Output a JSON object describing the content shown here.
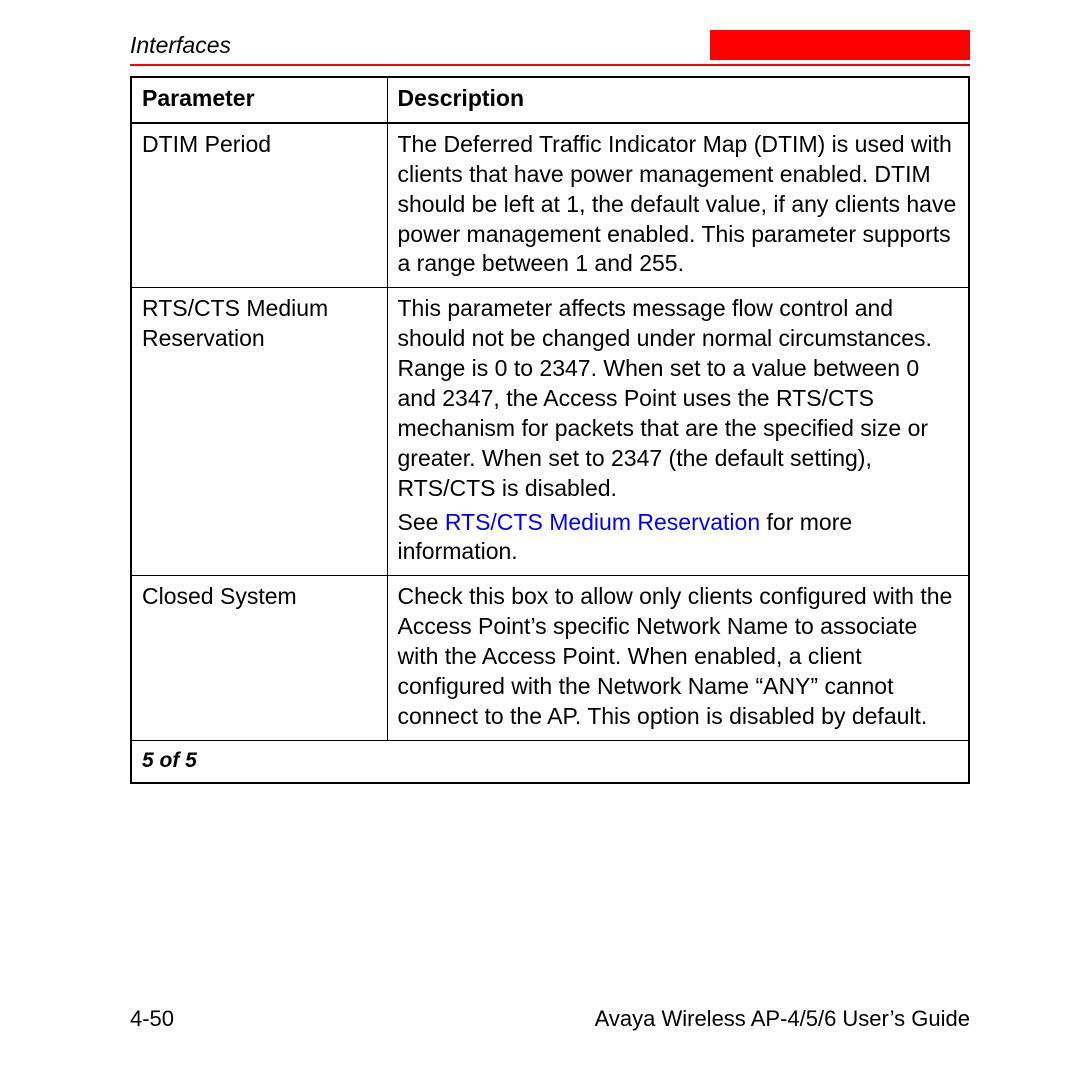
{
  "header": {
    "section": "Interfaces"
  },
  "table": {
    "headers": {
      "param": "Parameter",
      "desc": "Description"
    },
    "rows": [
      {
        "param": "DTIM Period",
        "desc_plain": "The Deferred Traffic Indicator Map (DTIM) is used with clients that have power management enabled. DTIM should be left at 1, the default value, if any clients have power management enabled. This parameter supports a range between 1 and 255."
      },
      {
        "param": "RTS/CTS Medium Reservation",
        "desc_p1": "This parameter affects message flow control and should not be changed under normal circumstances. Range is 0 to 2347. When set to a value between 0 and 2347, the Access Point uses the RTS/CTS mechanism for packets that are the specified size or greater. When set to 2347 (the default setting), RTS/CTS is disabled.",
        "desc_p2_pre": "See ",
        "desc_p2_link": "RTS/CTS Medium Reservation",
        "desc_p2_post": " for more information."
      },
      {
        "param": "Closed System",
        "desc_plain": "Check this box to allow only clients configured with the Access Point’s specific Network Name to associate with the Access Point. When enabled, a client configured with the Network Name “ANY” cannot connect to the AP. This option is disabled by default."
      }
    ],
    "pager": "5 of 5"
  },
  "footer": {
    "page": "4-50",
    "guide": "Avaya Wireless AP-4/5/6 User’s Guide"
  }
}
